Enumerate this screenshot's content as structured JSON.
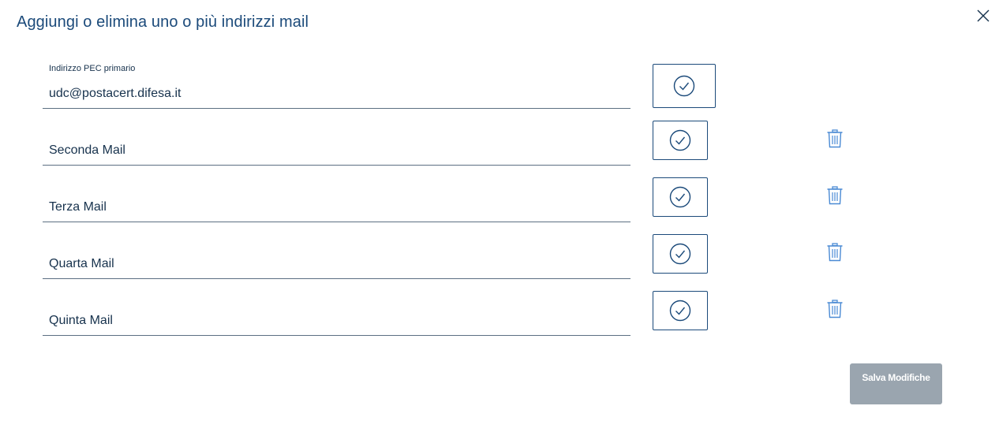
{
  "modal": {
    "title": "Aggiungi o elimina uno o più indirizzi mail",
    "close_icon": "close-icon"
  },
  "emails": [
    {
      "label": "Indirizzo PEC primario",
      "value": "udc@postacert.difesa.it",
      "placeholder": "",
      "deletable": false
    },
    {
      "label": "",
      "value": "",
      "placeholder": "Seconda Mail",
      "deletable": true
    },
    {
      "label": "",
      "value": "",
      "placeholder": "Terza Mail",
      "deletable": true
    },
    {
      "label": "",
      "value": "",
      "placeholder": "Quarta Mail",
      "deletable": true
    },
    {
      "label": "",
      "value": "",
      "placeholder": "Quinta Mail",
      "deletable": true
    }
  ],
  "icons": {
    "confirm": "check-circle-icon",
    "delete": "trash-icon"
  },
  "actions": {
    "save_label": "Salva Modifiche",
    "save_disabled": true
  },
  "colors": {
    "primary": "#1b4a7a",
    "text": "#17324d",
    "underline": "#5c6f82",
    "trash": "#4a8ad4",
    "disabled_button": "#9aa5af"
  }
}
